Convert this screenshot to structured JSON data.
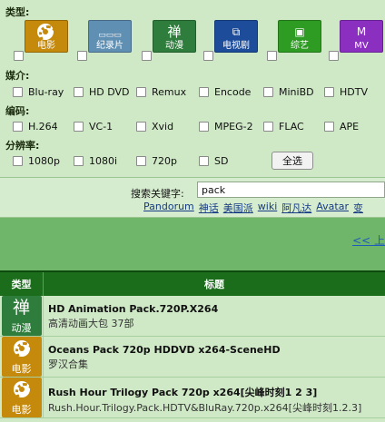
{
  "filter": {
    "type_label": "类型:",
    "categories": [
      {
        "label": "电影",
        "icon": "film-reel-icon",
        "color": "#c58a0c"
      },
      {
        "label": "纪录片",
        "icon": "bbc-tv-icon",
        "color": "#5f8fb3"
      },
      {
        "label": "动漫",
        "icon": "zen-character-icon",
        "color": "#2f7d3c",
        "glyph": "禅"
      },
      {
        "label": "电视剧",
        "icon": "tv-screens-icon",
        "color": "#1d4d9a"
      },
      {
        "label": "综艺",
        "icon": "variety-tv-icon",
        "color": "#2e9b22"
      },
      {
        "label": "MV",
        "icon": "mtv-icon",
        "color": "#8a2fbf"
      }
    ],
    "media_label": "媒介:",
    "media": [
      "Blu-ray",
      "HD DVD",
      "Remux",
      "Encode",
      "MiniBD",
      "HDTV"
    ],
    "codec_label": "编码:",
    "codecs": [
      "H.264",
      "VC-1",
      "Xvid",
      "MPEG-2",
      "FLAC",
      "APE"
    ],
    "resolution_label": "分辨率:",
    "resolutions": [
      "1080p",
      "1080i",
      "720p",
      "SD"
    ],
    "select_all": "全选"
  },
  "search": {
    "label": "搜索关键字:",
    "value": "pack",
    "hot_keywords": [
      "Pandorum",
      "神话",
      "美国派",
      "wiki",
      "阿凡达",
      "Avatar",
      "变"
    ]
  },
  "pager": {
    "prev": "<< 上"
  },
  "table": {
    "headers": {
      "type": "类型",
      "title": "标题"
    },
    "rows": [
      {
        "type_label": "动漫",
        "type_icon": "zen-character-icon",
        "type_color": "#2f7d3c",
        "glyph": "禅",
        "title": "HD Animation Pack.720P.X264",
        "subtitle": "高清动画大包 37部"
      },
      {
        "type_label": "电影",
        "type_icon": "film-reel-icon",
        "type_color": "#c58a0c",
        "title": "Oceans Pack 720p HDDVD x264-SceneHD",
        "subtitle": "罗汉合集"
      },
      {
        "type_label": "电影",
        "type_icon": "film-reel-icon",
        "type_color": "#c58a0c",
        "title": "Rush Hour Trilogy Pack 720p x264[尖峰时刻1 2 3]",
        "subtitle": "Rush.Hour.Trilogy.Pack.HDTV&BluRay.720p.x264[尖峰时刻1.2.3]"
      }
    ]
  }
}
